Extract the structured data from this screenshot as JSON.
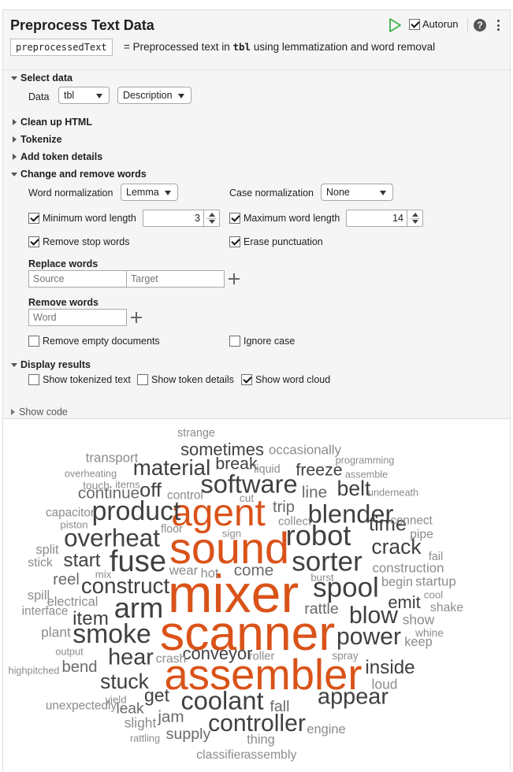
{
  "header": {
    "title": "Preprocess Text Data",
    "output_variable": "preprocessedText",
    "summary_prefix": "= Preprocessed text in",
    "summary_var": "tbl",
    "summary_suffix": "using lemmatization and word removal",
    "autorun_label": "Autorun",
    "autorun_checked": true,
    "help_label": "?"
  },
  "select_data": {
    "section_label": "Select data",
    "data_label": "Data",
    "table_value": "tbl",
    "variable_value": "Description"
  },
  "collapsed_sections": [
    {
      "label": "Clean up HTML"
    },
    {
      "label": "Tokenize"
    },
    {
      "label": "Add token details"
    }
  ],
  "change_remove": {
    "section_label": "Change and remove words",
    "word_normalization_label": "Word normalization",
    "word_normalization_value": "Lemma",
    "case_normalization_label": "Case normalization",
    "case_normalization_value": "None",
    "min_length_label": "Minimum word length",
    "min_length_checked": true,
    "min_length_value": "3",
    "max_length_label": "Maximum word length",
    "max_length_checked": true,
    "max_length_value": "14",
    "remove_stop_words_label": "Remove stop words",
    "remove_stop_words_checked": true,
    "erase_punctuation_label": "Erase punctuation",
    "erase_punctuation_checked": true,
    "replace_words_label": "Replace words",
    "source_placeholder": "Source",
    "target_placeholder": "Target",
    "remove_words_label": "Remove words",
    "word_placeholder": "Word",
    "remove_empty_label": "Remove empty documents",
    "remove_empty_checked": false,
    "ignore_case_label": "Ignore case",
    "ignore_case_checked": false
  },
  "display_results": {
    "section_label": "Display results",
    "show_tokenized_label": "Show tokenized text",
    "show_tokenized_checked": false,
    "show_token_details_label": "Show token details",
    "show_token_details_checked": false,
    "show_word_cloud_label": "Show word cloud",
    "show_word_cloud_checked": true
  },
  "show_code_label": "Show code",
  "colors": {
    "accent_orange": "#d95319",
    "dark_gray": "#404040",
    "mid_gray": "#6a6a6a",
    "light_gray": "#8c8c8c",
    "run_green": "#3cb24a"
  },
  "word_cloud": {
    "words": [
      {
        "text": "mixer",
        "weight": 1.0,
        "tone": "accent"
      },
      {
        "text": "scanner",
        "weight": 0.92,
        "tone": "accent"
      },
      {
        "text": "sound",
        "weight": 0.82,
        "tone": "accent"
      },
      {
        "text": "assembler",
        "weight": 0.8,
        "tone": "accent"
      },
      {
        "text": "agent",
        "weight": 0.7,
        "tone": "accent"
      },
      {
        "text": "fuse",
        "weight": 0.55,
        "tone": "dark"
      },
      {
        "text": "robot",
        "weight": 0.52,
        "tone": "dark"
      },
      {
        "text": "arm",
        "weight": 0.52,
        "tone": "dark"
      },
      {
        "text": "sorter",
        "weight": 0.5,
        "tone": "dark"
      },
      {
        "text": "spool",
        "weight": 0.5,
        "tone": "dark"
      },
      {
        "text": "smoke",
        "weight": 0.48,
        "tone": "dark"
      },
      {
        "text": "product",
        "weight": 0.48,
        "tone": "dark"
      },
      {
        "text": "software",
        "weight": 0.46,
        "tone": "dark"
      },
      {
        "text": "coolant",
        "weight": 0.46,
        "tone": "dark"
      },
      {
        "text": "blender",
        "weight": 0.46,
        "tone": "dark"
      },
      {
        "text": "overheat",
        "weight": 0.44,
        "tone": "dark"
      },
      {
        "text": "controller",
        "weight": 0.42,
        "tone": "dark"
      },
      {
        "text": "power",
        "weight": 0.42,
        "tone": "dark"
      },
      {
        "text": "blow",
        "weight": 0.42,
        "tone": "dark"
      },
      {
        "text": "appear",
        "weight": 0.4,
        "tone": "dark"
      },
      {
        "text": "hear",
        "weight": 0.4,
        "tone": "dark"
      },
      {
        "text": "construct",
        "weight": 0.38,
        "tone": "dark"
      },
      {
        "text": "material",
        "weight": 0.38,
        "tone": "dark"
      },
      {
        "text": "stuck",
        "weight": 0.36,
        "tone": "dark"
      },
      {
        "text": "belt",
        "weight": 0.36,
        "tone": "dark"
      },
      {
        "text": "crack",
        "weight": 0.36,
        "tone": "dark"
      },
      {
        "text": "time",
        "weight": 0.34,
        "tone": "dark"
      },
      {
        "text": "off",
        "weight": 0.34,
        "tone": "dark"
      },
      {
        "text": "item",
        "weight": 0.32,
        "tone": "dark"
      },
      {
        "text": "start",
        "weight": 0.32,
        "tone": "dark"
      },
      {
        "text": "inside",
        "weight": 0.32,
        "tone": "dark"
      },
      {
        "text": "get",
        "weight": 0.3,
        "tone": "dark"
      },
      {
        "text": "sometimes",
        "weight": 0.28,
        "tone": "dark"
      },
      {
        "text": "conveyor",
        "weight": 0.28,
        "tone": "dark"
      },
      {
        "text": "emit",
        "weight": 0.28,
        "tone": "dark"
      },
      {
        "text": "break",
        "weight": 0.27,
        "tone": "dark"
      },
      {
        "text": "freeze",
        "weight": 0.27,
        "tone": "dark"
      },
      {
        "text": "line",
        "weight": 0.26,
        "tone": "mid"
      },
      {
        "text": "jam",
        "weight": 0.26,
        "tone": "mid"
      },
      {
        "text": "continue",
        "weight": 0.26,
        "tone": "mid"
      },
      {
        "text": "come",
        "weight": 0.26,
        "tone": "mid"
      },
      {
        "text": "bend",
        "weight": 0.25,
        "tone": "mid"
      },
      {
        "text": "reel",
        "weight": 0.25,
        "tone": "mid"
      },
      {
        "text": "trip",
        "weight": 0.25,
        "tone": "mid"
      },
      {
        "text": "supply",
        "weight": 0.24,
        "tone": "mid"
      },
      {
        "text": "fall",
        "weight": 0.24,
        "tone": "mid"
      },
      {
        "text": "rattle",
        "weight": 0.24,
        "tone": "mid"
      },
      {
        "text": "leak",
        "weight": 0.23,
        "tone": "mid"
      },
      {
        "text": "plant",
        "weight": 0.2,
        "tone": "light"
      },
      {
        "text": "loud",
        "weight": 0.2,
        "tone": "light"
      },
      {
        "text": "show",
        "weight": 0.2,
        "tone": "light"
      },
      {
        "text": "slight",
        "weight": 0.2,
        "tone": "light"
      },
      {
        "text": "transport",
        "weight": 0.19,
        "tone": "light"
      },
      {
        "text": "occasionally",
        "weight": 0.19,
        "tone": "light"
      },
      {
        "text": "construction",
        "weight": 0.19,
        "tone": "light"
      },
      {
        "text": "wear",
        "weight": 0.19,
        "tone": "light"
      },
      {
        "text": "startup",
        "weight": 0.19,
        "tone": "light"
      },
      {
        "text": "split",
        "weight": 0.18,
        "tone": "light"
      },
      {
        "text": "spill",
        "weight": 0.18,
        "tone": "light"
      },
      {
        "text": "thing",
        "weight": 0.18,
        "tone": "light"
      },
      {
        "text": "engine",
        "weight": 0.18,
        "tone": "light"
      },
      {
        "text": "keep",
        "weight": 0.18,
        "tone": "light"
      },
      {
        "text": "electrical",
        "weight": 0.18,
        "tone": "light"
      },
      {
        "text": "hot",
        "weight": 0.18,
        "tone": "light"
      },
      {
        "text": "begin",
        "weight": 0.18,
        "tone": "light"
      },
      {
        "text": "stick",
        "weight": 0.17,
        "tone": "light"
      },
      {
        "text": "crash",
        "weight": 0.17,
        "tone": "light"
      },
      {
        "text": "classifier",
        "weight": 0.17,
        "tone": "light"
      },
      {
        "text": "assembly",
        "weight": 0.17,
        "tone": "light"
      },
      {
        "text": "shake",
        "weight": 0.17,
        "tone": "light"
      },
      {
        "text": "pipe",
        "weight": 0.17,
        "tone": "light"
      },
      {
        "text": "control",
        "weight": 0.16,
        "tone": "light"
      },
      {
        "text": "interface",
        "weight": 0.16,
        "tone": "light"
      },
      {
        "text": "unexpectedly",
        "weight": 0.16,
        "tone": "light"
      },
      {
        "text": "capacitor",
        "weight": 0.16,
        "tone": "light"
      },
      {
        "text": "connect",
        "weight": 0.16,
        "tone": "light"
      },
      {
        "text": "roller",
        "weight": 0.15,
        "tone": "light"
      },
      {
        "text": "collect",
        "weight": 0.15,
        "tone": "light"
      },
      {
        "text": "liquid",
        "weight": 0.14,
        "tone": "light"
      },
      {
        "text": "fail",
        "weight": 0.14,
        "tone": "light"
      },
      {
        "text": "strange",
        "weight": 0.14,
        "tone": "light"
      },
      {
        "text": "floor",
        "weight": 0.14,
        "tone": "light"
      },
      {
        "text": "touch",
        "weight": 0.13,
        "tone": "light"
      },
      {
        "text": "cut",
        "weight": 0.13,
        "tone": "light"
      },
      {
        "text": "spray",
        "weight": 0.13,
        "tone": "light"
      },
      {
        "text": "whine",
        "weight": 0.13,
        "tone": "light"
      },
      {
        "text": "items",
        "weight": 0.12,
        "tone": "light"
      },
      {
        "text": "piston",
        "weight": 0.12,
        "tone": "light"
      },
      {
        "text": "sign",
        "weight": 0.12,
        "tone": "light"
      },
      {
        "text": "mix",
        "weight": 0.12,
        "tone": "light"
      },
      {
        "text": "burst",
        "weight": 0.12,
        "tone": "light"
      },
      {
        "text": "cool",
        "weight": 0.12,
        "tone": "light"
      },
      {
        "text": "yield",
        "weight": 0.12,
        "tone": "light"
      },
      {
        "text": "overheating",
        "weight": 0.11,
        "tone": "light"
      },
      {
        "text": "programming",
        "weight": 0.11,
        "tone": "light"
      },
      {
        "text": "assemble",
        "weight": 0.11,
        "tone": "light"
      },
      {
        "text": "underneath",
        "weight": 0.11,
        "tone": "light"
      },
      {
        "text": "output",
        "weight": 0.11,
        "tone": "light"
      },
      {
        "text": "highpitched",
        "weight": 0.11,
        "tone": "light"
      },
      {
        "text": "rattling",
        "weight": 0.11,
        "tone": "light"
      }
    ]
  }
}
